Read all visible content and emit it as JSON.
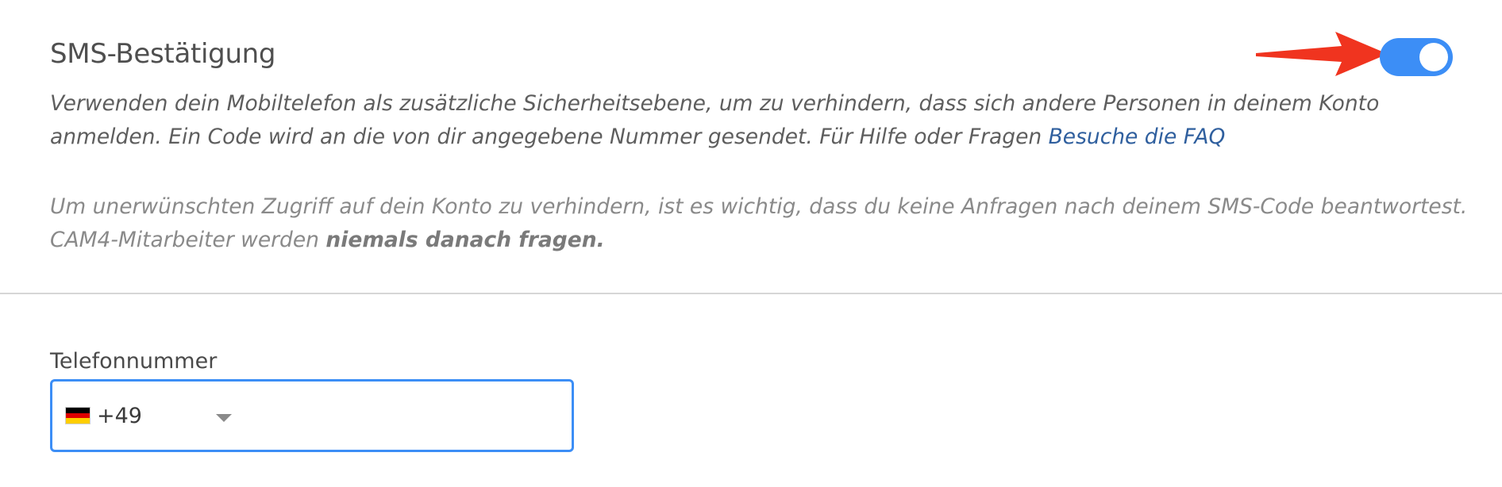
{
  "sms": {
    "title": "SMS-Bestätigung",
    "description": "Verwenden dein Mobiltelefon als zusätzliche Sicherheitsebene, um zu verhindern, dass sich andere Personen in deinem Konto anmelden. Ein Code wird an die von dir angegebene Nummer gesendet. Für Hilfe oder Fragen ",
    "faq_link": "Besuche die FAQ",
    "warning": "Um unerwünschten Zugriff auf dein Konto zu verhindern, ist es wichtig, dass du keine Anfragen nach deinem SMS-Code beantwortest. CAM4-Mitarbeiter werden ",
    "warning_bold": "niemals danach fragen.",
    "toggle_on": true
  },
  "phone": {
    "label": "Telefonnummer",
    "country_code": "+49",
    "country_flag": "germany-flag-icon",
    "value": ""
  },
  "colors": {
    "accent": "#3c8ef6",
    "annotation_arrow": "#f0341f",
    "link": "#2f5f9e"
  }
}
